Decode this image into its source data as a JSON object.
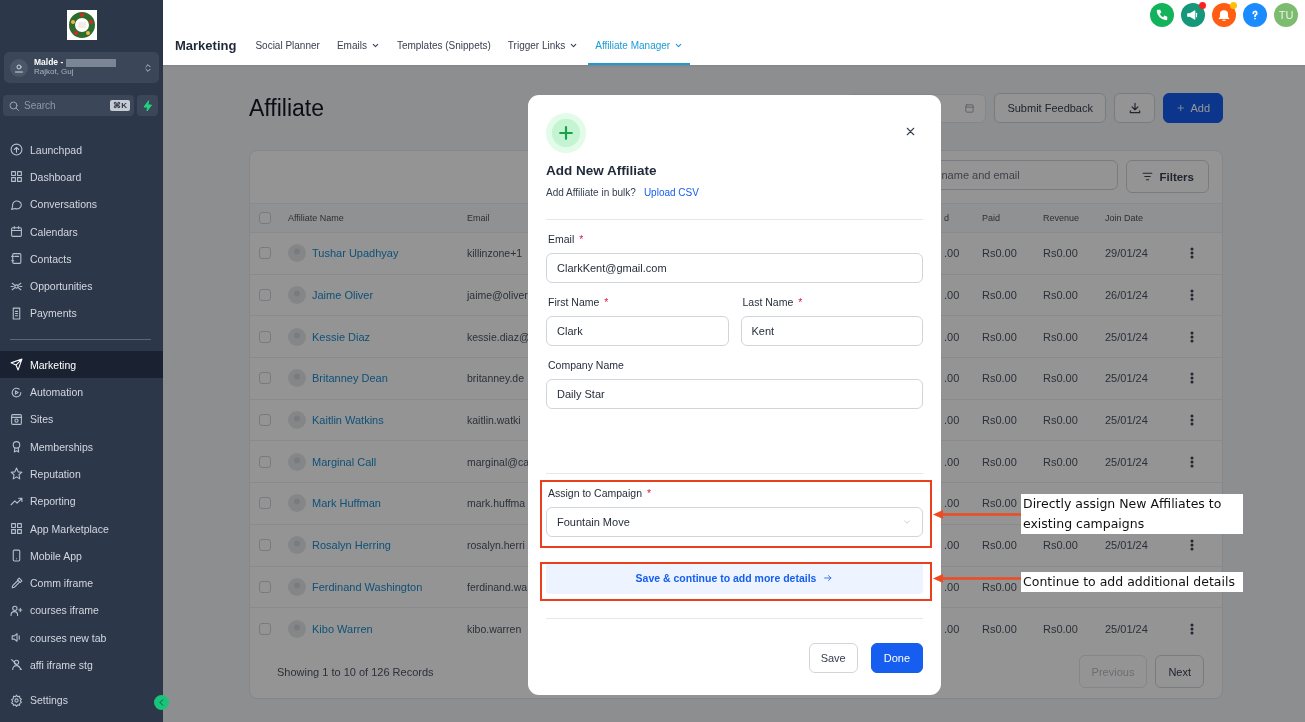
{
  "sidebar": {
    "account": {
      "name": "Malde -",
      "location": "Rajkot, Guj",
      "redacted": true
    },
    "search": {
      "placeholder": "Search",
      "shortcut": "⌘K"
    },
    "items": [
      {
        "label": "Launchpad",
        "selected": false
      },
      {
        "label": "Dashboard",
        "selected": false
      },
      {
        "label": "Conversations",
        "selected": false
      },
      {
        "label": "Calendars",
        "selected": false
      },
      {
        "label": "Contacts",
        "selected": false
      },
      {
        "label": "Opportunities",
        "selected": false
      },
      {
        "label": "Payments",
        "selected": false
      },
      {
        "label": "Marketing",
        "selected": true
      },
      {
        "label": "Automation",
        "selected": false
      },
      {
        "label": "Sites",
        "selected": false
      },
      {
        "label": "Memberships",
        "selected": false
      },
      {
        "label": "Reputation",
        "selected": false
      },
      {
        "label": "Reporting",
        "selected": false
      },
      {
        "label": "App Marketplace",
        "selected": false
      },
      {
        "label": "Mobile App",
        "selected": false
      },
      {
        "label": "Comm iframe",
        "selected": false
      },
      {
        "label": "courses iframe",
        "selected": false
      },
      {
        "label": "courses new tab",
        "selected": false
      },
      {
        "label": "affi iframe stg",
        "selected": false
      }
    ],
    "settings": {
      "label": "Settings"
    }
  },
  "topbar": {
    "title": "Marketing",
    "tabs": [
      {
        "label": "Social Planner",
        "dropdown": false,
        "selected": false
      },
      {
        "label": "Emails",
        "dropdown": true,
        "selected": false
      },
      {
        "label": "Templates (Snippets)",
        "dropdown": false,
        "selected": false
      },
      {
        "label": "Trigger Links",
        "dropdown": true,
        "selected": false
      },
      {
        "label": "Affiliate Manager",
        "dropdown": true,
        "selected": true
      }
    ],
    "actions": [
      {
        "kind": "phone",
        "color": "#12b35a"
      },
      {
        "kind": "megaphone",
        "color": "#15977a",
        "badge": {
          "color": "#ff1f1f"
        }
      },
      {
        "kind": "bell",
        "color": "#ff5d14",
        "badge": {
          "color": "#ffc107"
        }
      },
      {
        "kind": "help",
        "color": "#1a8cff"
      }
    ],
    "avatar": {
      "initials": "TU",
      "color": "#7dbb6e"
    }
  },
  "page": {
    "title": "Affiliate",
    "buttons": [
      {
        "kind": "feedback",
        "label": "Submit Feedback"
      },
      {
        "kind": "download"
      },
      {
        "kind": "add",
        "label": "Add"
      }
    ]
  },
  "table": {
    "search_placeholder": "name and email",
    "filters": "Filters",
    "columns": [
      "Affiliate Name",
      "Email",
      "d",
      "Paid",
      "Revenue",
      "Join Date"
    ],
    "all_checked": false,
    "rows": [
      {
        "checked": false,
        "name": "Tushar Upadhyay",
        "email": "killinzone+1",
        "column_3": ".00",
        "paid": "Rs0.00",
        "revenue": "Rs0.00",
        "join_date": "29/01/24"
      },
      {
        "checked": false,
        "name": "Jaime Oliver",
        "email": "jaime@oliver",
        "column_3": ".00",
        "paid": "Rs0.00",
        "revenue": "Rs0.00",
        "join_date": "26/01/24"
      },
      {
        "checked": false,
        "name": "Kessie Diaz",
        "email": "kessie.diaz@",
        "column_3": ".00",
        "paid": "Rs0.00",
        "revenue": "Rs0.00",
        "join_date": "25/01/24"
      },
      {
        "checked": false,
        "name": "Britanney Dean",
        "email": "britanney.de",
        "column_3": ".00",
        "paid": "Rs0.00",
        "revenue": "Rs0.00",
        "join_date": "25/01/24"
      },
      {
        "checked": false,
        "name": "Kaitlin Watkins",
        "email": "kaitlin.watki",
        "column_3": ".00",
        "paid": "Rs0.00",
        "revenue": "Rs0.00",
        "join_date": "25/01/24"
      },
      {
        "checked": false,
        "name": "Marginal Call",
        "email": "marginal@ca",
        "column_3": ".00",
        "paid": "Rs0.00",
        "revenue": "Rs0.00",
        "join_date": "25/01/24"
      },
      {
        "checked": false,
        "name": "Mark Huffman",
        "email": "mark.huffma",
        "column_3": ".00",
        "paid": "Rs0.00"
      },
      {
        "checked": false,
        "name": "Rosalyn Herring",
        "email": "rosalyn.herri",
        "column_3": ".00",
        "paid": "Rs0.00",
        "revenue": "Rs0.00",
        "join_date": "25/01/24"
      },
      {
        "checked": false,
        "name": "Ferdinand Washington",
        "email": "ferdinand.wa",
        "column_3": ".00",
        "paid": "Rs0.00"
      },
      {
        "checked": false,
        "name": "Kibo Warren",
        "email": "kibo.warren",
        "column_3": ".00",
        "paid": "Rs0.00",
        "revenue": "Rs0.00",
        "join_date": "25/01/24"
      }
    ],
    "summary": "Showing 1 to 10 of 126 Records",
    "pagination": [
      {
        "label": "Previous",
        "disabled": true
      },
      {
        "label": "Next",
        "disabled": false
      }
    ]
  },
  "modal": {
    "title": "Add New Affiliate",
    "bulk_text": "Add Affiliate in bulk?",
    "bulk_link": "Upload CSV",
    "field_rows": [
      [
        {
          "label": "Email",
          "required_mark": "*",
          "value": "ClarkKent@gmail.com"
        }
      ],
      [
        {
          "label": "First Name",
          "required_mark": "*",
          "value": "Clark"
        },
        {
          "label": "Last Name",
          "required_mark": "*",
          "value": "Kent"
        }
      ],
      [
        {
          "label": "Company Name",
          "value": "Daily Star"
        }
      ]
    ],
    "campaign": {
      "label": "Assign to Campaign",
      "required_mark": "*",
      "value": "Fountain Move"
    },
    "continue_button": "Save & continue to add more details",
    "buttons": [
      {
        "kind": "secondary",
        "label": "Save"
      },
      {
        "kind": "primary",
        "label": "Done"
      }
    ]
  },
  "annotations": [
    {
      "text": "Directly assign New Affiliates to existing campaigns"
    },
    {
      "text": "Continue to add additional details"
    }
  ]
}
